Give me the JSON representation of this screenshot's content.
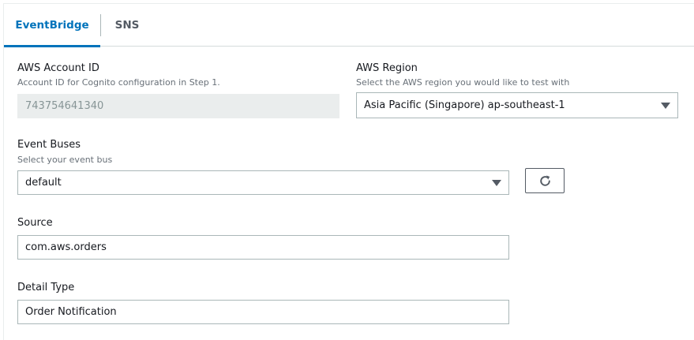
{
  "tabs": {
    "eventbridge": "EventBridge",
    "sns": "SNS",
    "active": "EventBridge"
  },
  "account": {
    "label": "AWS Account ID",
    "description": "Account ID for Cognito configuration in Step 1.",
    "value": "743754641340"
  },
  "region": {
    "label": "AWS Region",
    "description": "Select the AWS region you would like to test with",
    "value": "Asia Pacific (Singapore) ap-southeast-1"
  },
  "event_buses": {
    "label": "Event Buses",
    "description": "Select your event bus",
    "value": "default",
    "refresh_icon": "refresh-icon"
  },
  "source": {
    "label": "Source",
    "value": "com.aws.orders"
  },
  "detail_type": {
    "label": "Detail Type",
    "value": "Order Notification"
  },
  "colors": {
    "accent": "#0073bb",
    "border": "#aab7b8",
    "disabled_bg": "#eaeded"
  }
}
